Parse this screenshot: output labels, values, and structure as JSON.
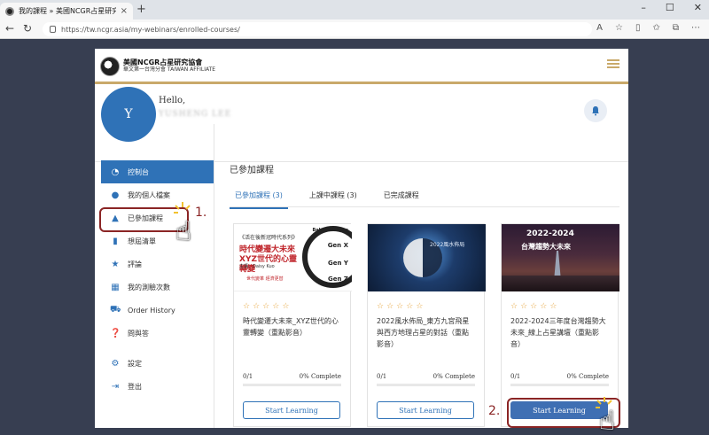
{
  "browser": {
    "tab_title": "我的課程 » 美國NCGR占星研究協",
    "url": "https://tw.ncgr.asia/my-webinars/enrolled-courses/",
    "new_tab": "+",
    "tab_close": "×"
  },
  "site": {
    "logo_line1": "美國NCGR占星研究協會",
    "logo_line2": "華文第一台灣分會 TAIWAN AFFILIATE"
  },
  "profile": {
    "avatar_letter": "Y",
    "greeting": "Hello,",
    "username": "YUSHENG LEE"
  },
  "sidebar": {
    "items": [
      {
        "label": "控制台",
        "icon": "dashboard-icon",
        "glyph": "◔"
      },
      {
        "label": "我的個人檔案",
        "icon": "user-icon",
        "glyph": "●"
      },
      {
        "label": "已參加課程",
        "icon": "graduation-cap-icon",
        "glyph": "▲"
      },
      {
        "label": "想屆清單",
        "icon": "bookmark-icon",
        "glyph": "▮"
      },
      {
        "label": "評論",
        "icon": "star-icon",
        "glyph": "★"
      },
      {
        "label": "我的測驗次數",
        "icon": "sitemap-icon",
        "glyph": "▦"
      },
      {
        "label": "Order History",
        "icon": "cart-icon",
        "glyph": "⛟"
      },
      {
        "label": "問與答",
        "icon": "qa-icon",
        "glyph": "❓"
      },
      {
        "label": "設定",
        "icon": "gear-icon",
        "glyph": "⚙"
      },
      {
        "label": "登出",
        "icon": "logout-icon",
        "glyph": "⇥"
      }
    ]
  },
  "main": {
    "title": "已參加課程",
    "tabs": [
      "已參加課程 (3)",
      "上課中課程 (3)",
      "已完成課程"
    ]
  },
  "courses": [
    {
      "title": "時代變遷大未來_XYZ世代的心靈轉變（重點影音）",
      "progress_text": "0/1",
      "complete_text": "0% Complete",
      "progress": 0,
      "button": "Start Learning",
      "thumb": {
        "small": "《活在後新冠時代系列》",
        "big": "時代變遷大未來 XYZ世代的心靈轉變",
        "sub": "主講：Daisy Kuo",
        "foot": "世代變革 經濟更替",
        "gens": [
          "Baby Boomers",
          "Gen X",
          "Gen Y",
          "Gen Z"
        ]
      }
    },
    {
      "title": "2022風水佈局_東方九宮飛星與西方地理占星的對話（重點影音）",
      "progress_text": "0/1",
      "complete_text": "0% Complete",
      "progress": 0,
      "button": "Start Learning",
      "thumb": {
        "caption": "2022風水佈局"
      }
    },
    {
      "title": "2022-2024三年度台灣趨勢大未來_線上占星講壇（重點影音）",
      "progress_text": "0/1",
      "complete_text": "0% Complete",
      "progress": 0,
      "button": "Start Learning",
      "thumb": {
        "year": "2022-2024",
        "caption": "台灣趨勢大未來"
      }
    }
  ],
  "annotations": {
    "step1": "1.",
    "step2": "2."
  },
  "colors": {
    "primary": "#2f72b7",
    "gold": "#c9a96a",
    "annotation": "#8b2525",
    "star": "#e6a43b"
  }
}
